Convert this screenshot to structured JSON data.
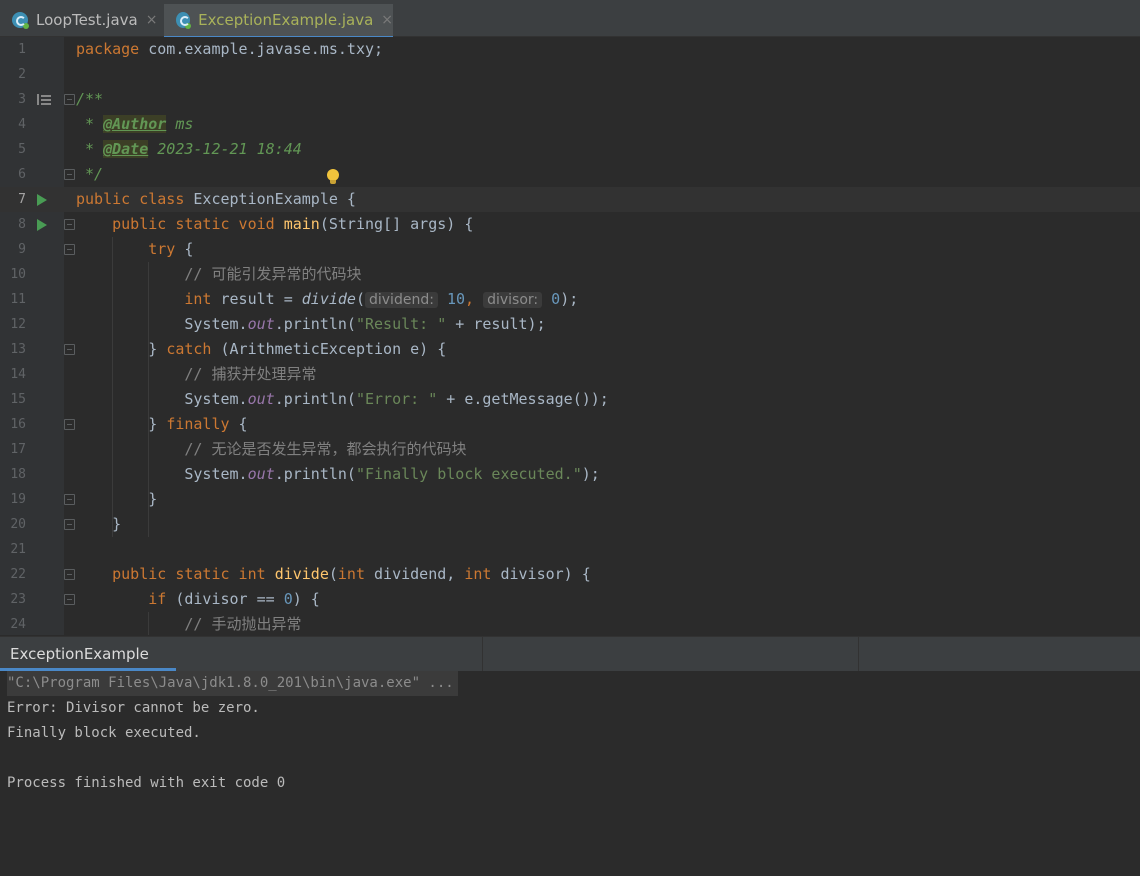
{
  "tabs": [
    {
      "label": "LoopTest.java",
      "active": false,
      "close": "×"
    },
    {
      "label": "ExceptionExample.java",
      "active": true,
      "close": "×"
    }
  ],
  "editor": {
    "line_numbers": [
      "1",
      "2",
      "3",
      "4",
      "5",
      "6",
      "7",
      "8",
      "9",
      "10",
      "11",
      "12",
      "13",
      "14",
      "15",
      "16",
      "17",
      "18",
      "19",
      "20",
      "21",
      "22",
      "23",
      "24"
    ],
    "l1": {
      "kw": "package",
      "pkg": " com.example.javase.ms.txy;"
    },
    "l3": {
      "doc": "/**"
    },
    "l4": {
      "star": " * ",
      "tag": "@Author",
      "val": " ms"
    },
    "l5": {
      "star": " * ",
      "tag": "@Date",
      "val": " 2023-12-21 18:44"
    },
    "l6": {
      "doc": " */"
    },
    "l7": {
      "kw": "public class",
      "name": " ExceptionExample {"
    },
    "l8": {
      "kw": "public static void",
      "fn": "main",
      "rest": "(String[] args) {"
    },
    "l9": {
      "kw": "try",
      "rest": " {"
    },
    "l10": {
      "comment": "// 可能引发异常的代码块"
    },
    "l11": {
      "kw": "int",
      "a": " result = ",
      "fn": "divide",
      "b": "(",
      "hint1": "dividend:",
      "n1": "10",
      "c": ", ",
      "hint2": "divisor:",
      "n2": "0",
      "d": ");"
    },
    "l12": {
      "a": "System.",
      "fld": "out",
      "b": ".println(",
      "str": "\"Result: \"",
      "c": " + result);"
    },
    "l13": {
      "a": "} ",
      "kw": "catch",
      "b": " (ArithmeticException e) {"
    },
    "l14": {
      "comment": "// 捕获并处理异常"
    },
    "l15": {
      "a": "System.",
      "fld": "out",
      "b": ".println(",
      "str": "\"Error: \"",
      "c": " + e.getMessage());"
    },
    "l16": {
      "a": "} ",
      "kw": "finally",
      "b": " {"
    },
    "l17": {
      "comment": "// 无论是否发生异常，都会执行的代码块"
    },
    "l18": {
      "a": "System.",
      "fld": "out",
      "b": ".println(",
      "str": "\"Finally block executed.\"",
      "c": ");"
    },
    "l19": {
      "a": "}"
    },
    "l20": {
      "a": "}"
    },
    "l22": {
      "kw": "public static int",
      "fn": "divide",
      "a": "(",
      "kw2": "int",
      "b": " dividend, ",
      "kw3": "int",
      "c": " divisor) {"
    },
    "l23": {
      "kw": "if",
      "a": " (divisor == ",
      "num": "0",
      "b": ") {"
    },
    "l24": {
      "comment": "// 手动抛出异常"
    }
  },
  "run_panel": {
    "tab_label": "ExceptionExample",
    "console": [
      "\"C:\\Program Files\\Java\\jdk1.8.0_201\\bin\\java.exe\" ...",
      "Error: Divisor cannot be zero.",
      "Finally block executed.",
      "",
      "Process finished with exit code 0"
    ]
  },
  "colors": {
    "keyword": "#cc7832",
    "string": "#6a8759",
    "number": "#6897bb",
    "function": "#ffc66d",
    "comment": "#808080",
    "doc": "#629755"
  },
  "icons": [
    "java-class-icon",
    "close-icon",
    "run-icon",
    "doc-icon",
    "fold-icon",
    "lightbulb-icon"
  ]
}
